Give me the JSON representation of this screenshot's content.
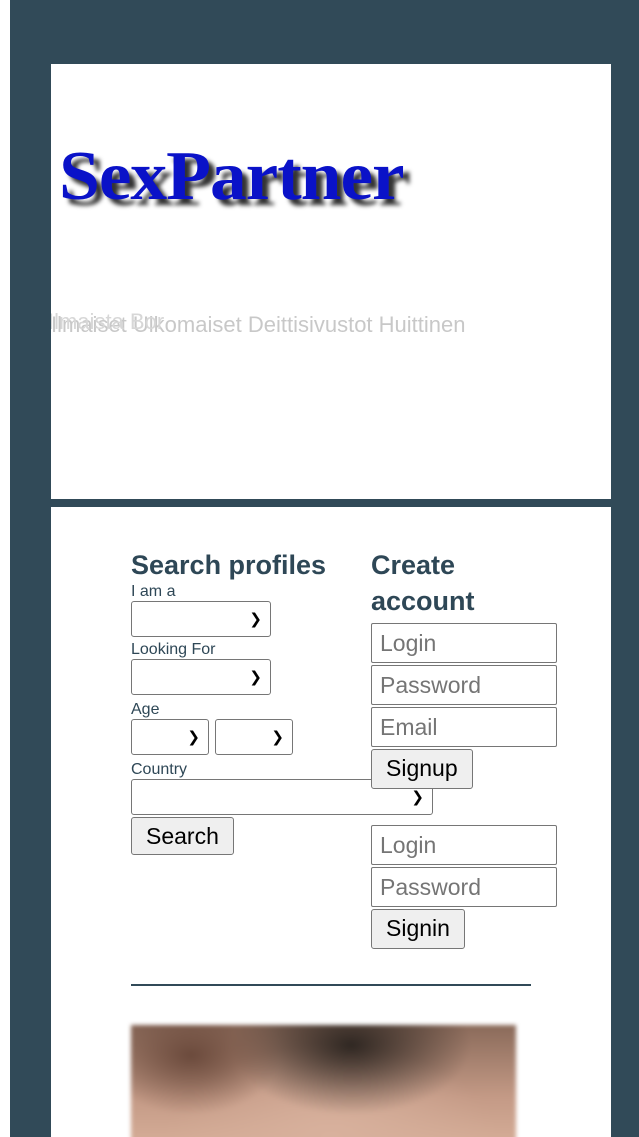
{
  "header": {
    "logo_text": "SexPartner",
    "tagline": "Ilmaiset Ulkomaiset Deittisivustot Huittinen",
    "tagline_overlay": "Ilmaista Bor"
  },
  "search": {
    "heading": "Search profiles",
    "i_am_label": "I am a",
    "i_am_value": "",
    "looking_for_label": "Looking For",
    "looking_for_value": "",
    "age_label": "Age",
    "age_from_value": "",
    "age_to_value": "",
    "country_label": "Country",
    "country_value": "",
    "search_button": "Search"
  },
  "signup": {
    "heading": "Create account",
    "login_placeholder": "Login",
    "password_placeholder": "Password",
    "email_placeholder": "Email",
    "signup_button": "Signup"
  },
  "signin": {
    "login_placeholder": "Login",
    "password_placeholder": "Password",
    "signin_button": "Signin"
  },
  "colors": {
    "frame": "#314a58",
    "logo": "#0a12c8",
    "heading": "#2e4756"
  }
}
